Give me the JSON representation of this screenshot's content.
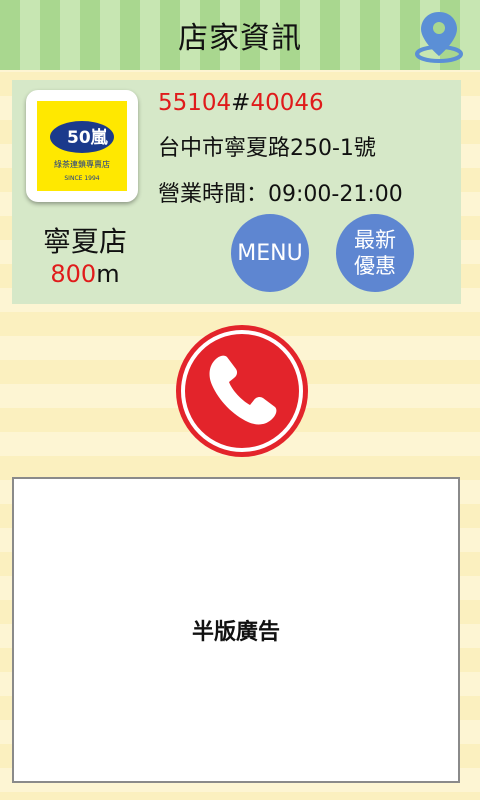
{
  "header": {
    "title": "店家資訊",
    "map_icon": "map-pin-icon"
  },
  "store": {
    "logo_text": "50嵐",
    "logo_subtitle": "綠茶連鎖專賣店",
    "logo_since": "SINCE 1994",
    "name": "寧夏店",
    "distance_value": "800",
    "distance_unit": "m",
    "code_a": "55104",
    "code_sep": "#",
    "code_b": "40046",
    "address": "台中市寧夏路250-1號",
    "hours": "營業時間：09:00-21:00"
  },
  "buttons": {
    "menu_label": "MENU",
    "promo_line1": "最新",
    "promo_line2": "優惠",
    "call_icon": "phone-icon"
  },
  "ad": {
    "label": "半版廣告"
  },
  "colors": {
    "header_green": "#a9d78f",
    "card_green": "#d6e8c8",
    "button_blue": "#5e86d1",
    "accent_red": "#e01b1b",
    "logo_yellow": "#ffe800"
  }
}
